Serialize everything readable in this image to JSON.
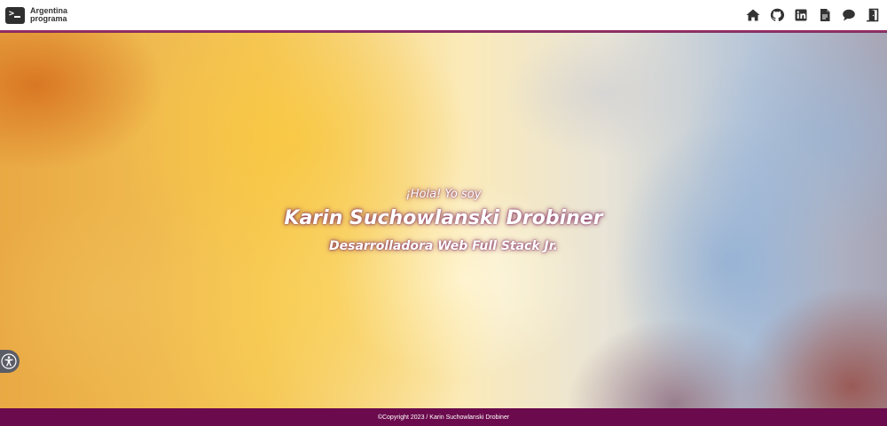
{
  "brand": {
    "line1": "Argentina",
    "line2": "programa"
  },
  "nav": {
    "icons": [
      "home-icon",
      "github-icon",
      "linkedin-icon",
      "document-icon",
      "comment-icon",
      "logout-door-icon"
    ]
  },
  "hero": {
    "greeting": "¡Hola! Yo soy",
    "name": "Karin Suchowlanski Drobiner",
    "role": "Desarrolladora Web Full Stack Jr."
  },
  "accessibility": {
    "icon": "accessibility-icon"
  },
  "footer": {
    "copyright": "©Copyright 2023 / Karin Suchowlanski Drobiner"
  },
  "colors": {
    "accent": "#6b0a4c",
    "nav_border": "#7a1f55",
    "icon": "#333333"
  }
}
